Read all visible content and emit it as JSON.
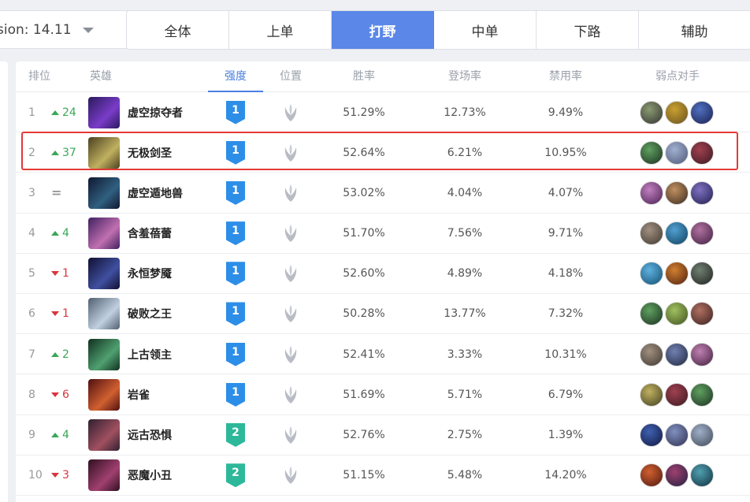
{
  "version": {
    "label": "sion: 14.11"
  },
  "lanes": [
    {
      "label": "全体",
      "active": false
    },
    {
      "label": "上单",
      "active": false
    },
    {
      "label": "打野",
      "active": true
    },
    {
      "label": "中单",
      "active": false
    },
    {
      "label": "下路",
      "active": false
    },
    {
      "label": "辅助",
      "active": false
    }
  ],
  "columns": {
    "rank": "排位",
    "hero": "英雄",
    "tier": "强度",
    "position": "位置",
    "win_rate": "胜率",
    "pick_rate": "登场率",
    "ban_rate": "禁用率",
    "counters": "弱点对手"
  },
  "colors": {
    "accent": "#5b87e8",
    "up": "#3aa757",
    "down": "#d9363e",
    "tier1": "#2d8ee8",
    "tier2": "#2db89a",
    "highlight": "#e53935"
  },
  "position_icon": "jungle-claw-icon",
  "rows": [
    {
      "rank": "1",
      "change": "24",
      "dir": "up",
      "hero": "虚空掠夺者",
      "tier": "1",
      "win": "51.29%",
      "pick": "12.73%",
      "ban": "9.49%",
      "avatar": [
        "#2a1a5e",
        "#7a3cc8"
      ],
      "counters": [
        [
          "#333",
          "#8a9a70"
        ],
        [
          "#6a5020",
          "#c8a030"
        ],
        [
          "#1a2050",
          "#5070c0"
        ]
      ]
    },
    {
      "rank": "2",
      "change": "37",
      "dir": "up",
      "hero": "无极剑圣",
      "tier": "1",
      "win": "52.64%",
      "pick": "6.21%",
      "ban": "10.95%",
      "avatar": [
        "#4a4020",
        "#c0b060"
      ],
      "counters": [
        [
          "#1a3020",
          "#60a060"
        ],
        [
          "#505878",
          "#a0b0d0"
        ],
        [
          "#3a1a20",
          "#a04050"
        ]
      ]
    },
    {
      "rank": "3",
      "change": "=",
      "dir": "same",
      "hero": "虚空遁地兽",
      "tier": "1",
      "win": "53.02%",
      "pick": "4.04%",
      "ban": "4.07%",
      "avatar": [
        "#101830",
        "#306080"
      ],
      "counters": [
        [
          "#4a2050",
          "#c080c0"
        ],
        [
          "#3a2a20",
          "#c09060"
        ],
        [
          "#202050",
          "#8070c0"
        ]
      ]
    },
    {
      "rank": "4",
      "change": "4",
      "dir": "up",
      "hero": "含羞蓓蕾",
      "tier": "1",
      "win": "51.70%",
      "pick": "7.56%",
      "ban": "9.71%",
      "avatar": [
        "#402060",
        "#c070b0"
      ],
      "counters": [
        [
          "#403830",
          "#a09080"
        ],
        [
          "#104060",
          "#50a0d0"
        ],
        [
          "#402040",
          "#b070a0"
        ]
      ]
    },
    {
      "rank": "5",
      "change": "1",
      "dir": "down",
      "hero": "永恒梦魇",
      "tier": "1",
      "win": "52.60%",
      "pick": "4.89%",
      "ban": "4.18%",
      "avatar": [
        "#101030",
        "#4050a0"
      ],
      "counters": [
        [
          "#105070",
          "#60b0e0"
        ],
        [
          "#502010",
          "#d08030"
        ],
        [
          "#202020",
          "#708070"
        ]
      ]
    },
    {
      "rank": "6",
      "change": "1",
      "dir": "down",
      "hero": "破败之王",
      "tier": "1",
      "win": "50.28%",
      "pick": "13.77%",
      "ban": "7.32%",
      "avatar": [
        "#506070",
        "#c0d0e0"
      ],
      "counters": [
        [
          "#1a3020",
          "#60a060"
        ],
        [
          "#405020",
          "#a0c060"
        ],
        [
          "#3a2020",
          "#b07060"
        ]
      ]
    },
    {
      "rank": "7",
      "change": "2",
      "dir": "up",
      "hero": "上古领主",
      "tier": "1",
      "win": "52.41%",
      "pick": "3.33%",
      "ban": "10.31%",
      "avatar": [
        "#103020",
        "#50a070"
      ],
      "counters": [
        [
          "#403830",
          "#a09080"
        ],
        [
          "#202840",
          "#7080b0"
        ],
        [
          "#402040",
          "#c080b0"
        ]
      ]
    },
    {
      "rank": "8",
      "change": "6",
      "dir": "down",
      "hero": "岩雀",
      "tier": "1",
      "win": "51.69%",
      "pick": "5.71%",
      "ban": "6.79%",
      "avatar": [
        "#501010",
        "#d06030"
      ],
      "counters": [
        [
          "#404020",
          "#c0b060"
        ],
        [
          "#3a1a20",
          "#a04050"
        ],
        [
          "#1a3020",
          "#60a060"
        ]
      ]
    },
    {
      "rank": "9",
      "change": "4",
      "dir": "up",
      "hero": "远古恐惧",
      "tier": "2",
      "win": "52.76%",
      "pick": "2.75%",
      "ban": "1.39%",
      "avatar": [
        "#302030",
        "#a05060"
      ],
      "counters": [
        [
          "#101840",
          "#4060b0"
        ],
        [
          "#303050",
          "#8090c0"
        ],
        [
          "#404858",
          "#a0b0c8"
        ]
      ]
    },
    {
      "rank": "10",
      "change": "3",
      "dir": "down",
      "hero": "恶魔小丑",
      "tier": "2",
      "win": "51.15%",
      "pick": "5.48%",
      "ban": "14.20%",
      "avatar": [
        "#301020",
        "#a04070"
      ],
      "counters": [
        [
          "#501810",
          "#d06030"
        ],
        [
          "#202040",
          "#a04070"
        ],
        [
          "#103040",
          "#50a0b0"
        ]
      ]
    }
  ]
}
